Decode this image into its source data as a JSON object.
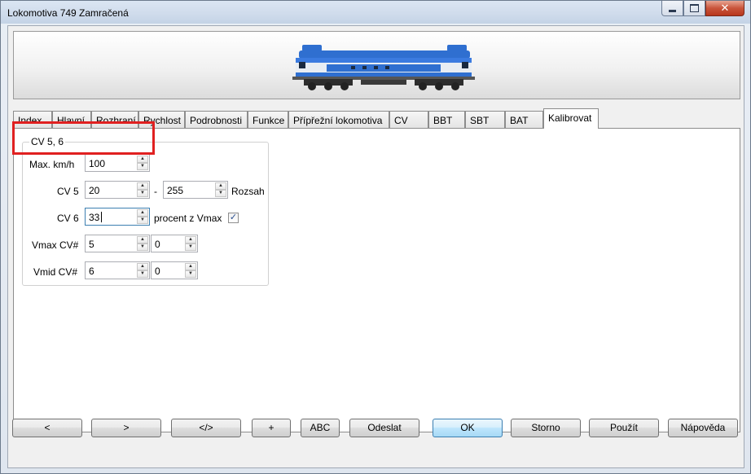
{
  "window": {
    "title": "Lokomotiva 749 Zamračená"
  },
  "tabs": [
    {
      "label": "Index",
      "active": false
    },
    {
      "label": "Hlavní",
      "active": false
    },
    {
      "label": "Rozhraní",
      "active": false
    },
    {
      "label": "Rychlost",
      "active": false
    },
    {
      "label": "Podrobnosti",
      "active": false
    },
    {
      "label": "Funkce",
      "active": false
    },
    {
      "label": "Přípřežní lokomotiva",
      "active": false
    },
    {
      "label": "CV",
      "active": false
    },
    {
      "label": "BBT",
      "active": false
    },
    {
      "label": "SBT",
      "active": false
    },
    {
      "label": "BAT",
      "active": false
    },
    {
      "label": "Kalibrovat",
      "active": true
    }
  ],
  "calibration": {
    "group_title": "CV 5, 6",
    "max_kmh": {
      "label": "Max. km/h",
      "value": "100"
    },
    "cv5": {
      "label": "CV 5",
      "min": "20",
      "separator": "-",
      "max": "255",
      "range_label": "Rozsah"
    },
    "cv6": {
      "label": "CV 6",
      "value": "33",
      "percent_label": "procent z Vmax",
      "percent_checked": true
    },
    "vmax": {
      "label": "Vmax CV#",
      "cv": "5",
      "extra": "0"
    },
    "vmid": {
      "label": "Vmid CV#",
      "cv": "6",
      "extra": "0"
    }
  },
  "buttons": {
    "prev": "<",
    "next": ">",
    "code": "</>",
    "plus": "+",
    "abc": "ABC",
    "send": "Odeslat",
    "ok": "OK",
    "cancel": "Storno",
    "apply": "Použít",
    "help": "Nápověda"
  },
  "colors": {
    "highlight": "#e02020",
    "loco_blue": "#2f6fd0",
    "loco_white": "#e8edf3"
  }
}
